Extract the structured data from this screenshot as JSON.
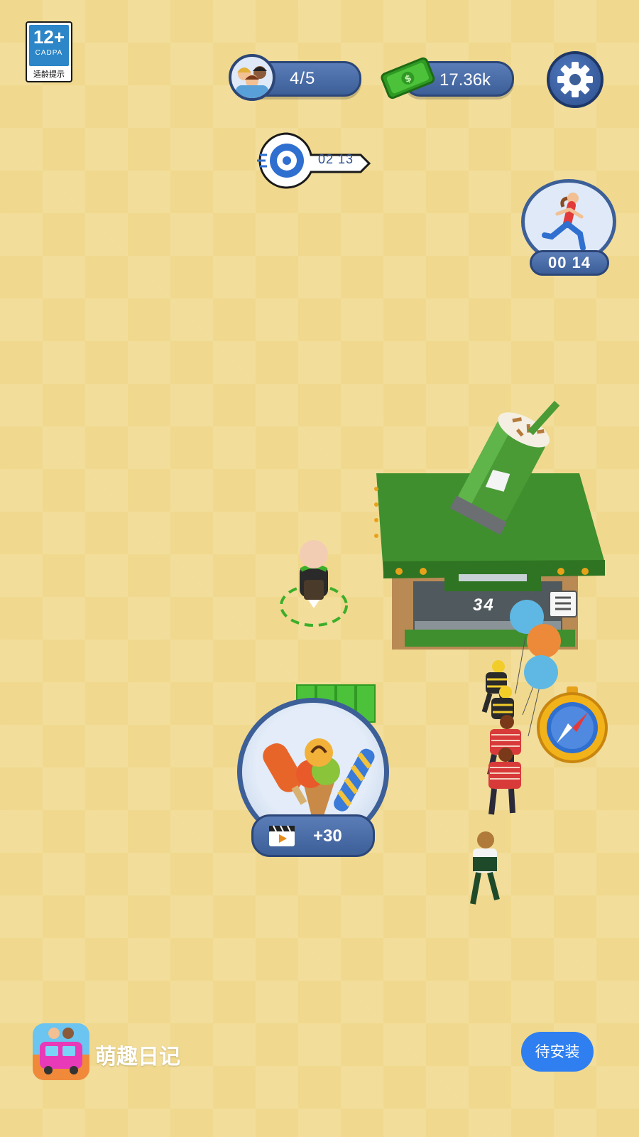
{
  "age_rating": {
    "number": "12+",
    "org": "CADPA",
    "caption": "适龄提示"
  },
  "hud": {
    "staff_count": "4/5",
    "cash": "17.36k",
    "key_timer": "02 13",
    "run_boost_timer": "00 14"
  },
  "stall": {
    "queue_count": "34"
  },
  "food_reward": {
    "label": "+30"
  },
  "ad": {
    "app_name": "萌趣日记",
    "install_label": "待安装"
  },
  "icons": {
    "staff": "staff-group-icon",
    "cash": "cash-bill-icon",
    "settings": "gear-icon",
    "key": "speed-key-icon",
    "run": "running-woman-icon",
    "video": "video-clapper-icon",
    "compass": "compass-icon"
  },
  "colors": {
    "ground": "#f0d98e",
    "hud_blue": "#3d5f98",
    "stall_green": "#3f8f2e",
    "install_blue": "#2f7ff0"
  }
}
